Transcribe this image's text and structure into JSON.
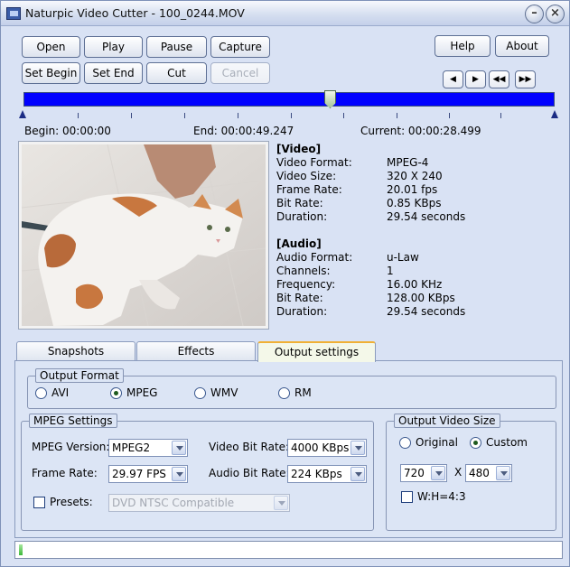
{
  "window": {
    "title": "Naturpic Video Cutter - 100_0244.MOV",
    "minimize_icon": "minimize-icon",
    "close_icon": "close-icon"
  },
  "toolbar": {
    "open": "Open",
    "play": "Play",
    "pause": "Pause",
    "capture": "Capture",
    "set_begin": "Set Begin",
    "set_end": "Set End",
    "cut": "Cut",
    "cancel": "Cancel",
    "help": "Help",
    "about": "About"
  },
  "nav": {
    "prev_icon": "step-back-icon",
    "next_icon": "step-forward-icon",
    "rewind_icon": "rewind-icon",
    "fast_forward_icon": "fast-forward-icon"
  },
  "timeline": {
    "position_fraction": 0.577,
    "begin_label": "Begin: 00:00:00",
    "end_label": "End: 00:00:49.247",
    "current_label": "Current: 00:00:28.499",
    "track_color": "#0000ff"
  },
  "video_info": {
    "header": "[Video]",
    "rows": [
      {
        "label": "Video Format:",
        "value": "MPEG-4"
      },
      {
        "label": "Video Size:",
        "value": "320 X 240"
      },
      {
        "label": "Frame Rate:",
        "value": "20.01 fps"
      },
      {
        "label": "Bit Rate:",
        "value": "0.85 KBps"
      },
      {
        "label": "Duration:",
        "value": "29.54 seconds"
      }
    ]
  },
  "audio_info": {
    "header": "[Audio]",
    "rows": [
      {
        "label": "Audio Format:",
        "value": "u-Law"
      },
      {
        "label": "Channels:",
        "value": "1"
      },
      {
        "label": "Frequency:",
        "value": "16.00 KHz"
      },
      {
        "label": "Bit Rate:",
        "value": "128.00 KBps"
      },
      {
        "label": "Duration:",
        "value": "29.54 seconds"
      }
    ]
  },
  "tabs": [
    {
      "label": "Snapshots",
      "active": false
    },
    {
      "label": "Effects",
      "active": false
    },
    {
      "label": "Output settings",
      "active": true
    }
  ],
  "output_format": {
    "title": "Output Format",
    "options": [
      {
        "label": "AVI",
        "selected": false
      },
      {
        "label": "MPEG",
        "selected": true
      },
      {
        "label": "WMV",
        "selected": false
      },
      {
        "label": "RM",
        "selected": false
      }
    ]
  },
  "mpeg_settings": {
    "title": "MPEG Settings",
    "mpeg_version_label": "MPEG Version:",
    "mpeg_version_value": "MPEG2",
    "video_bitrate_label": "Video Bit Rate:",
    "video_bitrate_value": "4000 KBps",
    "frame_rate_label": "Frame Rate:",
    "frame_rate_value": "29.97 FPS",
    "audio_bitrate_label": "Audio Bit Rate:",
    "audio_bitrate_value": "224 KBps",
    "presets_label": "Presets:",
    "presets_checked": false,
    "presets_value": "DVD NTSC Compatible"
  },
  "output_video_size": {
    "title": "Output Video Size",
    "original_label": "Original",
    "original_selected": false,
    "custom_label": "Custom",
    "custom_selected": true,
    "width_value": "720",
    "times_sign": "X",
    "height_value": "480",
    "aspect_label": "W:H=4:3",
    "aspect_checked": false
  },
  "status": {
    "progress_fraction": 0.01
  }
}
